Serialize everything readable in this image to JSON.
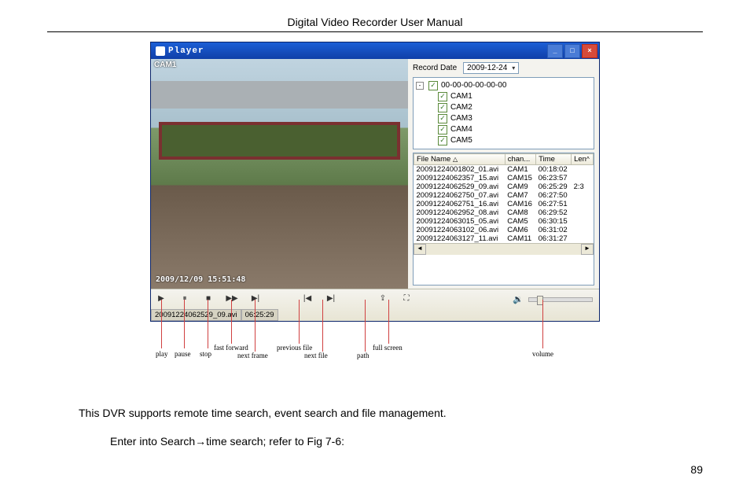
{
  "page": {
    "title": "Digital Video Recorder User Manual",
    "number": "89",
    "para1": "This DVR supports remote time search, event search and file management.",
    "para2": "Enter into Search→time search; refer to Fig 7-6:"
  },
  "window": {
    "title": "Player",
    "min": "_",
    "max": "□",
    "close": "×"
  },
  "video": {
    "camLabel": "CAM1",
    "timestamp": "2009/12/09 15:51:48"
  },
  "recordDate": {
    "label": "Record Date",
    "value": "2009-12-24"
  },
  "tree": {
    "root": "00-00-00-00-00-00",
    "items": [
      "CAM1",
      "CAM2",
      "CAM3",
      "CAM4",
      "CAM5"
    ]
  },
  "fileTable": {
    "headers": {
      "fileName": "File Name",
      "chan": "chan...",
      "time": "Time",
      "len": "Len"
    },
    "rows": [
      {
        "f": "20091224001802_01.avi",
        "c": "CAM1",
        "t": "00:18:02",
        "l": ""
      },
      {
        "f": "20091224062357_15.avi",
        "c": "CAM15",
        "t": "06:23:57",
        "l": ""
      },
      {
        "f": "20091224062529_09.avi",
        "c": "CAM9",
        "t": "06:25:29",
        "l": "2:3"
      },
      {
        "f": "20091224062750_07.avi",
        "c": "CAM7",
        "t": "06:27:50",
        "l": ""
      },
      {
        "f": "20091224062751_16.avi",
        "c": "CAM16",
        "t": "06:27:51",
        "l": ""
      },
      {
        "f": "20091224062952_08.avi",
        "c": "CAM8",
        "t": "06:29:52",
        "l": ""
      },
      {
        "f": "20091224063015_05.avi",
        "c": "CAM5",
        "t": "06:30:15",
        "l": ""
      },
      {
        "f": "20091224063102_06.avi",
        "c": "CAM6",
        "t": "06:31:02",
        "l": ""
      },
      {
        "f": "20091224063127_11.avi",
        "c": "CAM11",
        "t": "06:31:27",
        "l": ""
      }
    ]
  },
  "status": {
    "file": "20091224062529_09.avi",
    "time": "06:25:29"
  },
  "annotations": {
    "play": "play",
    "pause": "pause",
    "stop": "stop",
    "ff": "fast forward",
    "nextFrame": "next frame",
    "prevFile": "previous file",
    "nextFile": "next file",
    "path": "path",
    "fullscreen": "full screen",
    "volume": "volume"
  }
}
